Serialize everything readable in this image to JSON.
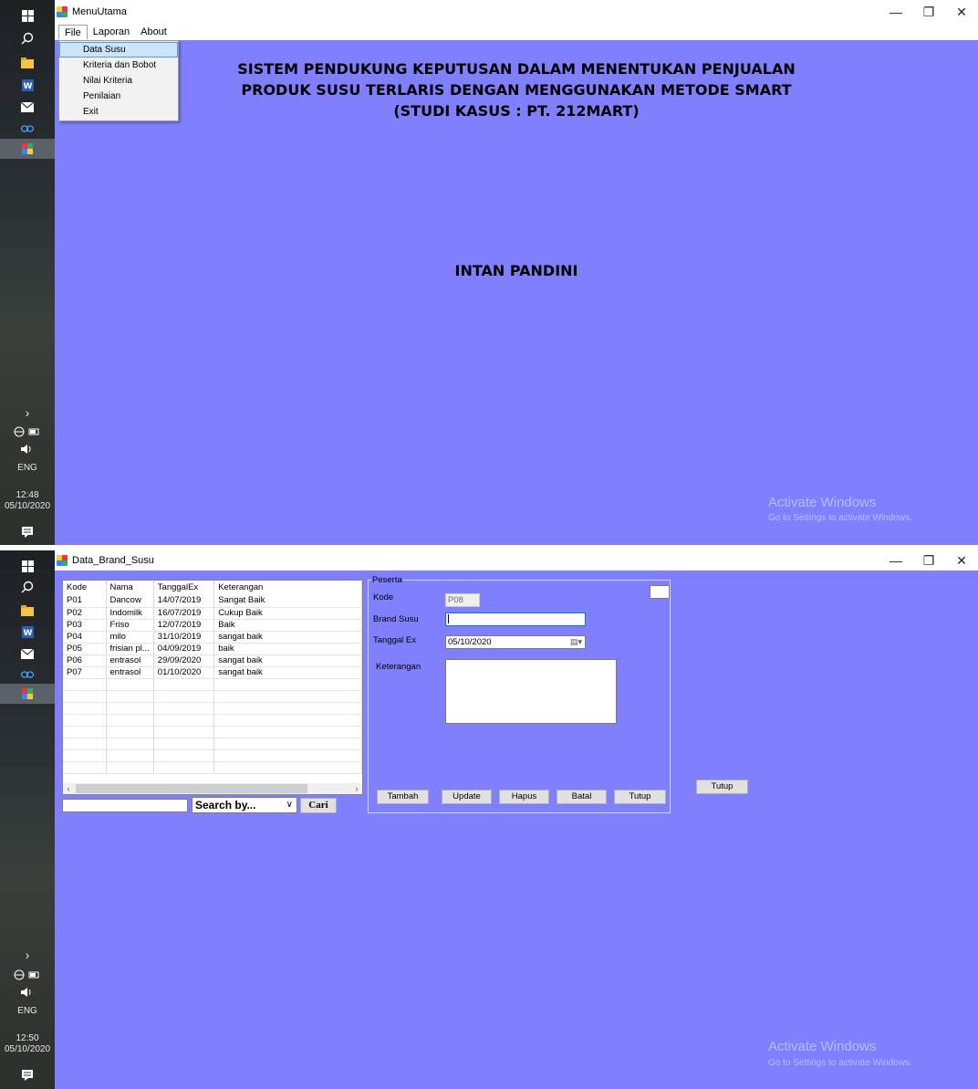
{
  "taskbar1": {
    "language": "ENG",
    "time": "12:48",
    "date": "05/10/2020"
  },
  "taskbar2": {
    "language": "ENG",
    "time": "12:50",
    "date": "05/10/2020"
  },
  "taskbar_icons": [
    "windows-start-icon",
    "search-icon",
    "file-explorer-icon",
    "word-icon",
    "mail-icon",
    "link-icon",
    "app-icon"
  ],
  "window1": {
    "title": "MenuUtama",
    "menu": [
      "File",
      "Laporan",
      "About"
    ],
    "dropdown": [
      "Data Susu",
      "Kriteria dan Bobot",
      "Nilai Kriteria",
      "Penilaian",
      "Exit"
    ],
    "banner_line1": "SISTEM PENDUKUNG KEPUTUSAN DALAM MENENTUKAN PENJUALAN",
    "banner_line2": "PRODUK SUSU TERLARIS DENGAN MENGGUNAKAN METODE SMART",
    "banner_line3": "(STUDI KASUS : PT. 212MART)",
    "author": "INTAN PANDINI"
  },
  "window2": {
    "title": "Data_Brand_Susu",
    "grid": {
      "columns": [
        "Kode",
        "Nama",
        "TanggalEx",
        "Keterangan"
      ],
      "rows": [
        [
          "P01",
          "Dancow",
          "14/07/2019",
          "Sangat Baik"
        ],
        [
          "P02",
          "Indomilk",
          "16/07/2019",
          "Cukup Baik"
        ],
        [
          "P03",
          "Friso",
          "12/07/2019",
          "Baik"
        ],
        [
          "P04",
          "milo",
          "31/10/2019",
          "sangat baik"
        ],
        [
          "P05",
          "frisian pl...",
          "04/09/2019",
          "baik"
        ],
        [
          "P06",
          "entrasol",
          "29/09/2020",
          "sangat baik"
        ],
        [
          "P07",
          "entrasol",
          "01/10/2020",
          "sangat baik"
        ]
      ]
    },
    "search": {
      "input_value": "",
      "search_by": "Search by...",
      "cari": "Cari"
    },
    "group_title": "Peserta",
    "labels": {
      "kode": "Kode",
      "brand": "Brand Susu",
      "tanggal": "Tanggal Ex",
      "keterangan": "Keterangan"
    },
    "values": {
      "kode": "P08",
      "brand": "",
      "tanggal": "05/10/2020",
      "keterangan": ""
    },
    "buttons": [
      "Tambah",
      "Update",
      "Hapus",
      "Batal",
      "Tutup"
    ],
    "outer_button": "Tutup"
  },
  "watermark": {
    "line1": "Activate Windows",
    "line2": "Go to Settings to activate Windows."
  },
  "colors": {
    "window_bg": "#8080ff",
    "menu_highlight": "#cce4f7"
  }
}
